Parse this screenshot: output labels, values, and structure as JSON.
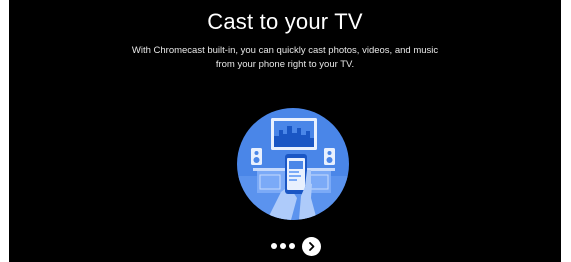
{
  "screen": {
    "title": "Cast to your TV",
    "subtitle_line1": "With Chromecast built-in, you can quickly cast photos, videos, and music",
    "subtitle_line2": "from your phone right to your TV."
  },
  "illustration": {
    "icon": "cast-to-tv-illustration",
    "colors": {
      "circle": "#4a86e8",
      "tv": "#e8f0fe",
      "hand": "#aecbfa"
    }
  },
  "pager": {
    "dots": 3,
    "next_icon": "chevron-right-icon"
  }
}
